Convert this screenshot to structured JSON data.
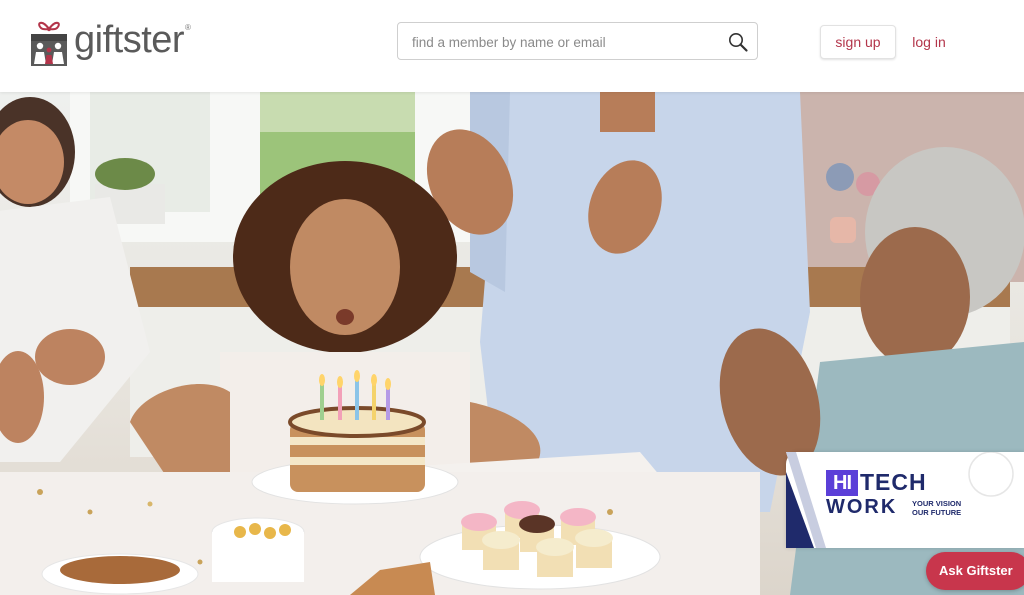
{
  "header": {
    "logo_text": "giftster",
    "logo_mark": "®",
    "search": {
      "placeholder": "find a member by name or email"
    },
    "signup_label": "sign up",
    "login_label": "log in"
  },
  "hero": {
    "scene": "birthday-cake-celebration-photo"
  },
  "badge": {
    "hi": "HI",
    "tech": "TECH",
    "work": "WORK",
    "tagline_1": "YOUR VISION",
    "tagline_2": "OUR FUTURE"
  },
  "chat_button_label": "Ask Giftster",
  "colors": {
    "brand": "#b3354a",
    "chat": "#c8364c",
    "badge_navy": "#1f2a6b",
    "badge_purple": "#5b3fd8"
  }
}
